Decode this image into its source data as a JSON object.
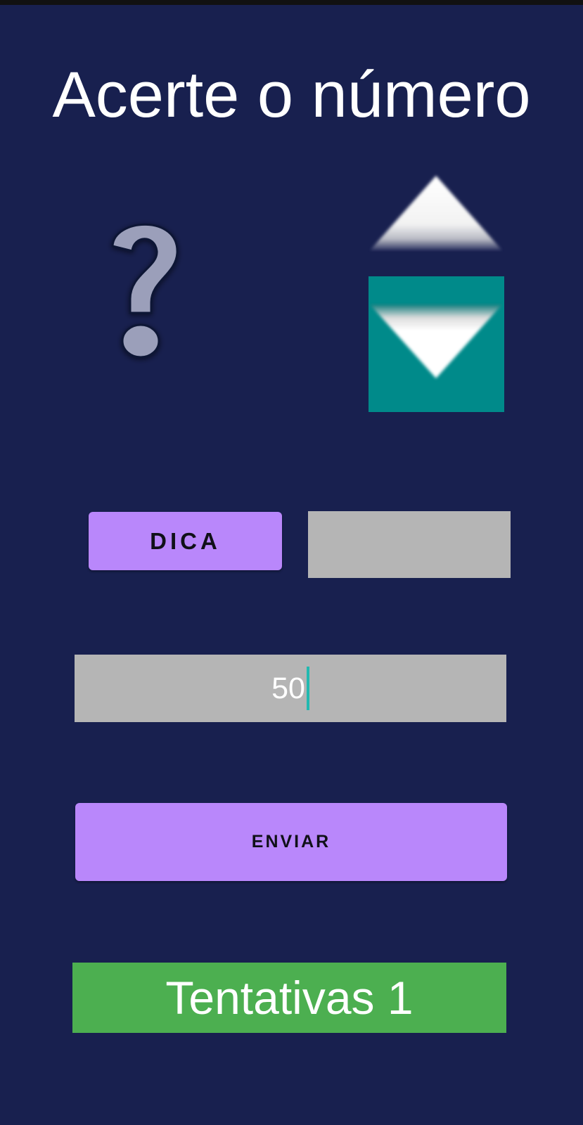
{
  "app": {
    "title": "Acerte o número"
  },
  "game": {
    "hint_image": "question-mark-icon",
    "higher_arrow": "arrow-up-icon",
    "lower_arrow": "arrow-down-icon",
    "lower_arrow_bg": "#008a8a",
    "hint_button_label": "DICA",
    "hint_text": "",
    "guess_value": "50",
    "submit_button_label": "ENVIAR",
    "attempts_label": "Tentativas 1"
  },
  "colors": {
    "background": "#18204f",
    "button": "#b987fb",
    "field": "#b5b5b5",
    "attempts_bg": "#4caf50",
    "caret": "#22b9b0"
  }
}
